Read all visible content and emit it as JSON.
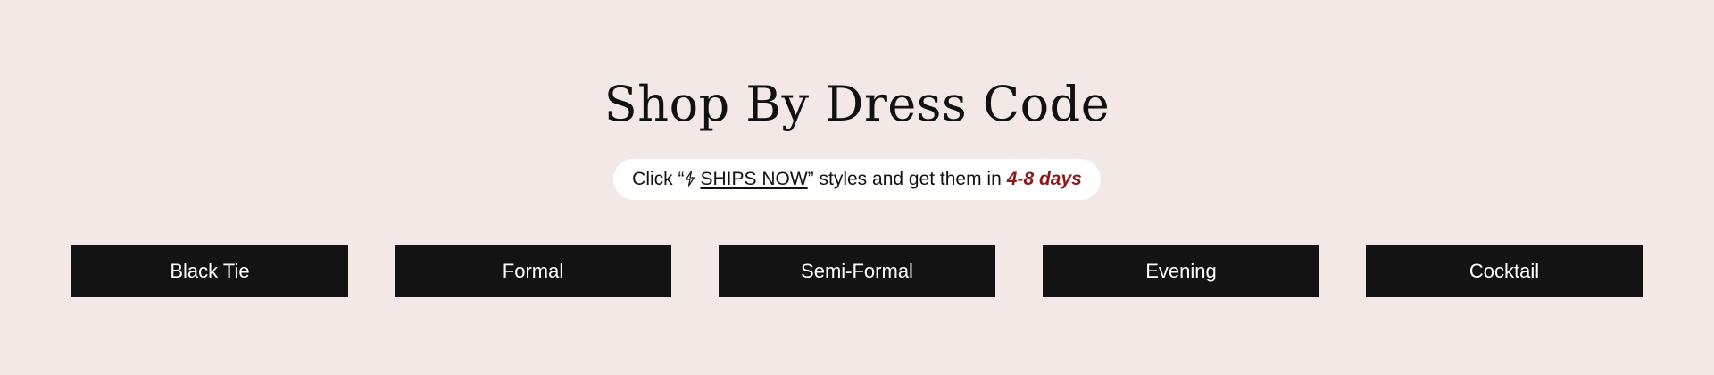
{
  "section": {
    "heading": "Shop By Dress Code"
  },
  "ships_banner": {
    "prefix": "Click “",
    "link_text": "SHIPS NOW",
    "middle": "” styles and get them in",
    "days": "4-8 days",
    "bolt_icon": "lightning-bolt-icon",
    "days_color": "#8b1a1a"
  },
  "dress_codes": [
    {
      "label": "Black Tie"
    },
    {
      "label": "Formal"
    },
    {
      "label": "Semi-Formal"
    },
    {
      "label": "Evening"
    },
    {
      "label": "Cocktail"
    }
  ],
  "colors": {
    "background": "#f2e9e6",
    "button_bg": "#131313",
    "button_text": "#ffffff"
  }
}
